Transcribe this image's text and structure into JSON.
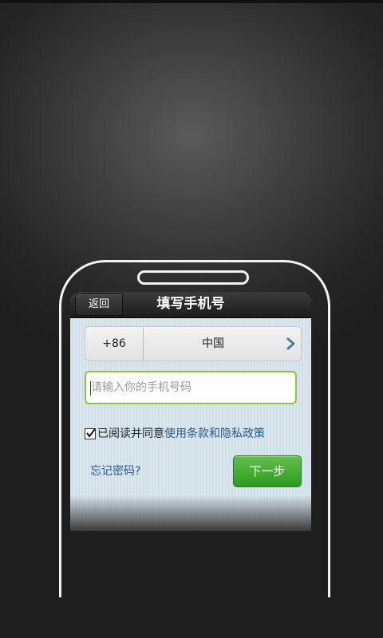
{
  "header": {
    "back_label": "返回",
    "title": "填写手机号"
  },
  "country": {
    "code": "+86",
    "name": "中国",
    "chevron_icon": "chevron-right-icon"
  },
  "phone_input": {
    "value": "",
    "placeholder": "请输入你的手机号码"
  },
  "agreement": {
    "checked": true,
    "prefix": "已阅读并同意",
    "link": "使用条款和隐私政策"
  },
  "forgot_label": "忘记密码?",
  "next_label": "下一步",
  "colors": {
    "accent_green": "#3aa82c",
    "input_border": "#8cc63f",
    "link_blue": "#2a5a8c",
    "title_bar": "#262626"
  }
}
